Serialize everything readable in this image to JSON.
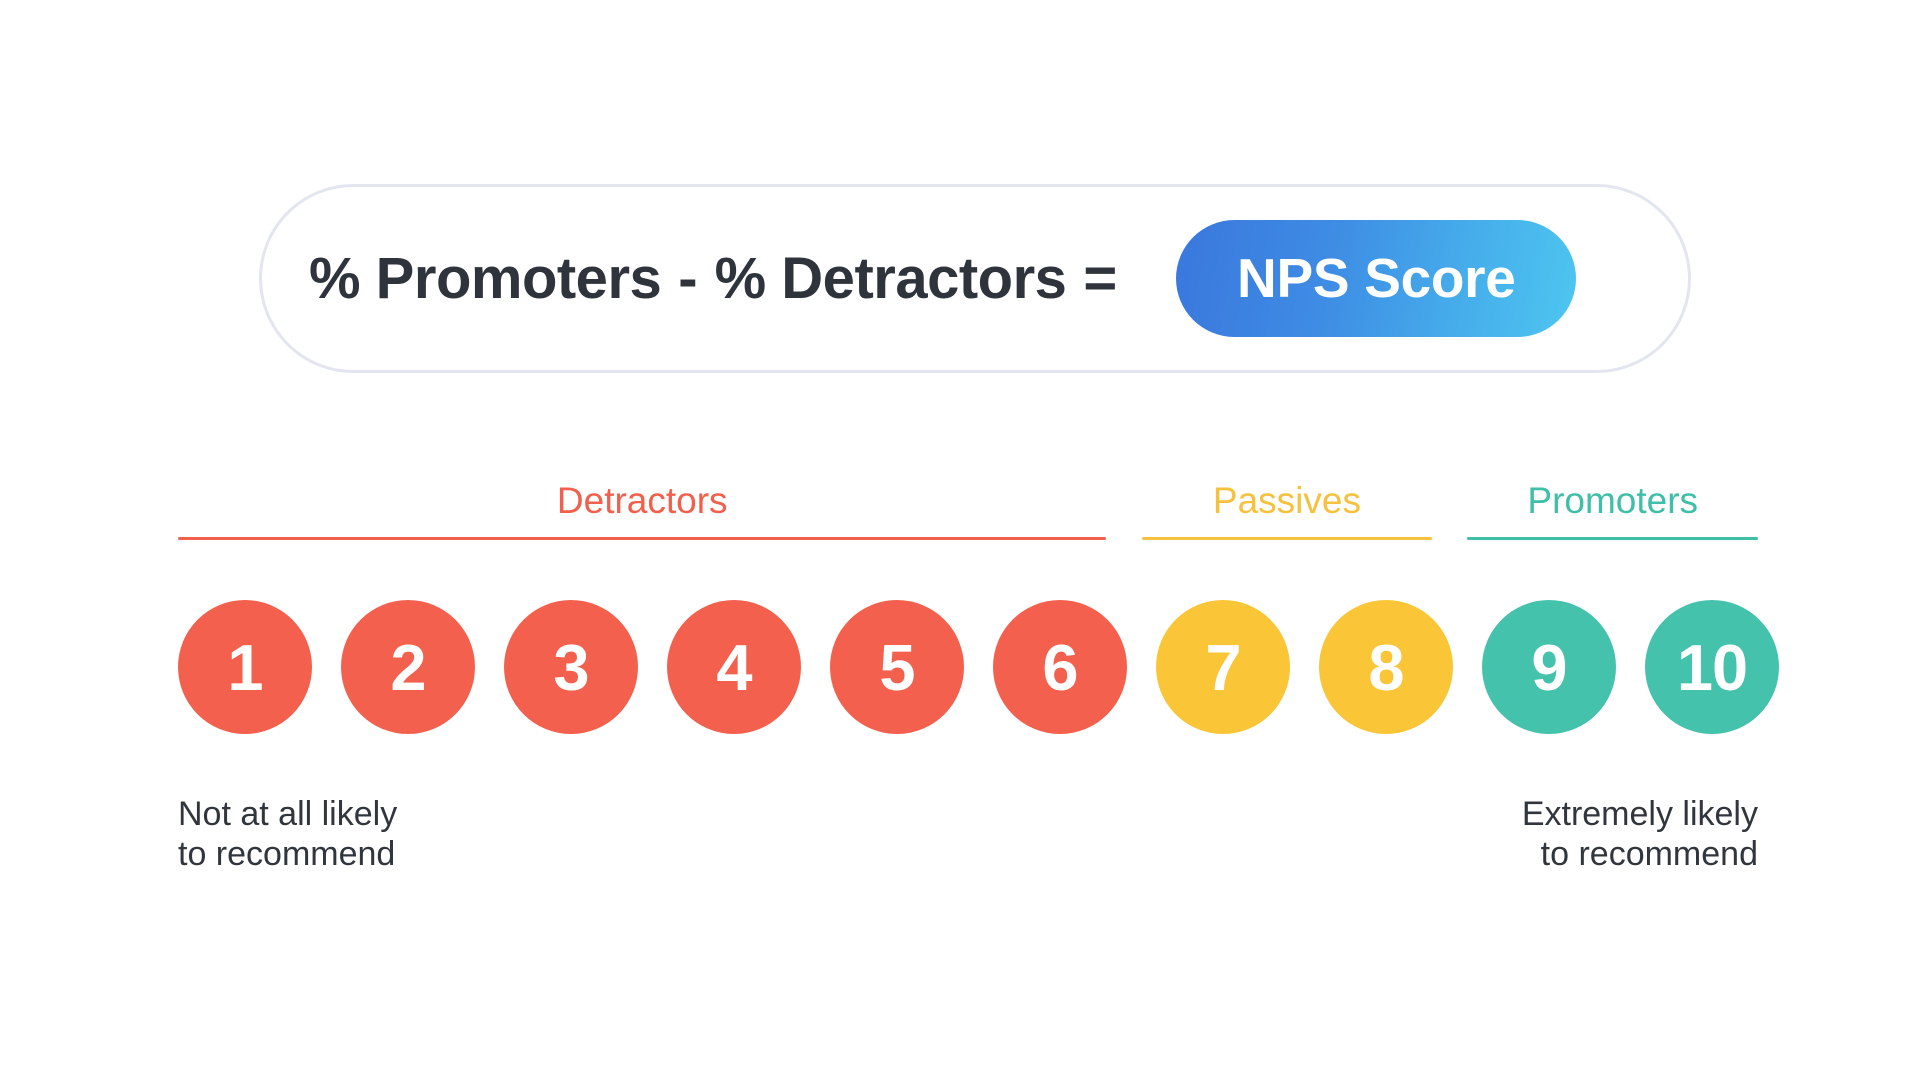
{
  "formula": {
    "promoters_term": "% Promoters",
    "minus_operator": "-",
    "detractors_term": "% Detractors",
    "equals_operator": "=",
    "result_label": "NPS Score",
    "result_gradient_start": "#3a77dd",
    "result_gradient_end": "#4ec6f0",
    "text_color": "#2f343c",
    "border_color": "#e3e5ef"
  },
  "scale": {
    "segments": [
      {
        "label": "Detractors",
        "color": "#f0604d",
        "scores": [
          1,
          2,
          3,
          4,
          5,
          6
        ]
      },
      {
        "label": "Passives",
        "color": "#f5c13e",
        "scores": [
          7,
          8
        ]
      },
      {
        "label": "Promoters",
        "color": "#3fbfa8",
        "scores": [
          9,
          10
        ]
      }
    ],
    "scores": [
      {
        "value": "1",
        "color": "#f4604e",
        "segment": "Detractors"
      },
      {
        "value": "2",
        "color": "#f4604e",
        "segment": "Detractors"
      },
      {
        "value": "3",
        "color": "#f4604e",
        "segment": "Detractors"
      },
      {
        "value": "4",
        "color": "#f4604e",
        "segment": "Detractors"
      },
      {
        "value": "5",
        "color": "#f4604e",
        "segment": "Detractors"
      },
      {
        "value": "6",
        "color": "#f4604e",
        "segment": "Detractors"
      },
      {
        "value": "7",
        "color": "#fac536",
        "segment": "Passives"
      },
      {
        "value": "8",
        "color": "#fac536",
        "segment": "Passives"
      },
      {
        "value": "9",
        "color": "#45c2ab",
        "segment": "Promoters"
      },
      {
        "value": "10",
        "color": "#45c2ab",
        "segment": "Promoters"
      }
    ],
    "caption_left": "Not at all likely\nto recommend",
    "caption_right": "Extremely likely\nto recommend"
  }
}
